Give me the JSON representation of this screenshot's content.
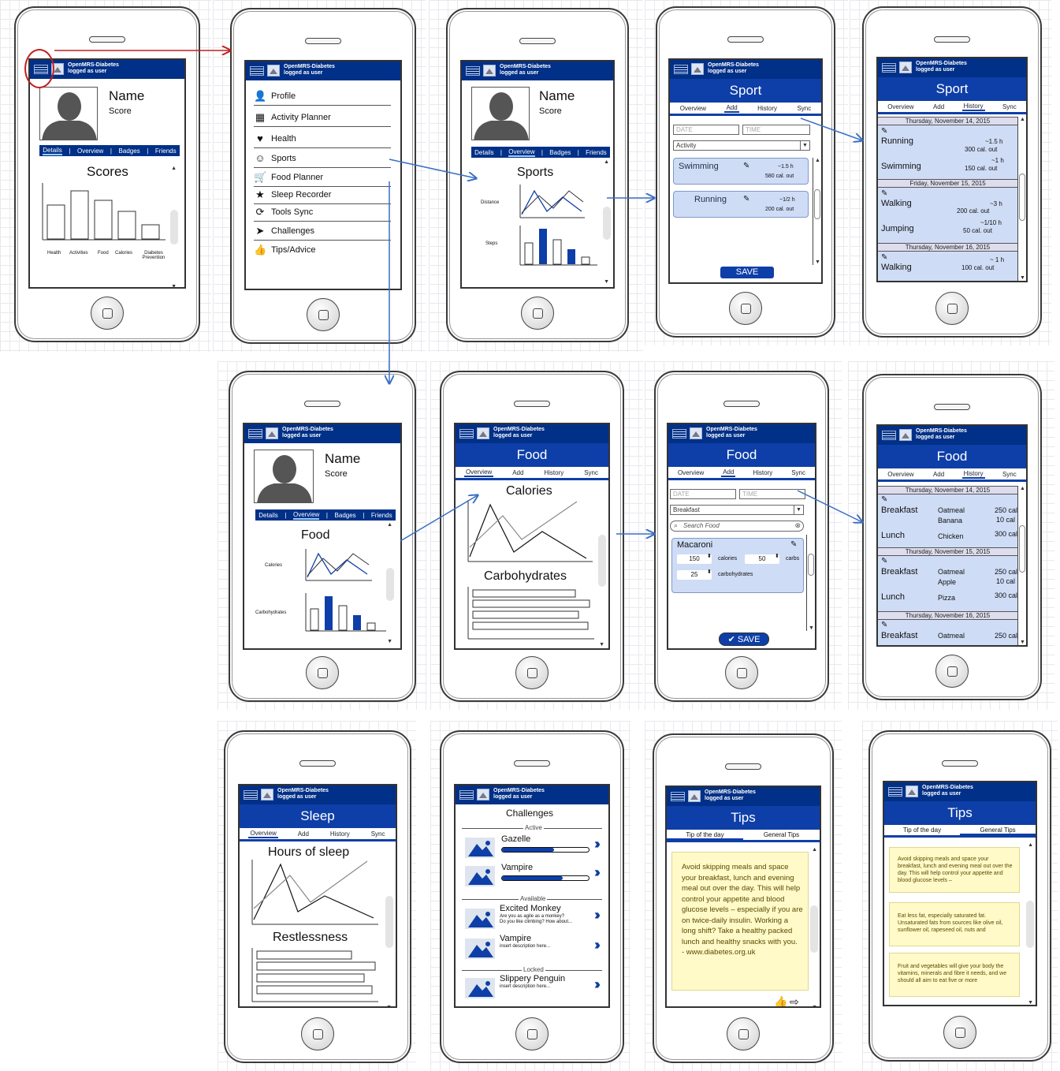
{
  "app": {
    "name": "OpenMRS-Diabetes",
    "login": "logged as user"
  },
  "profile": {
    "name": "Name",
    "score": "Score",
    "tabs": [
      "Details",
      "Overview",
      "Badges",
      "Friends"
    ],
    "scores_title": "Scores",
    "score_bars": [
      "Health",
      "Activities",
      "Food",
      "Calories",
      "Diabetes Prevention"
    ]
  },
  "menu": {
    "items": [
      "Profile",
      "Activity Planner",
      "Health",
      "Sports",
      "Food Planner",
      "Sleep Recorder",
      "Tools Sync",
      "Challenges",
      "Tips/Advice"
    ]
  },
  "sports_overview": {
    "title": "Sports",
    "distance": "Distance",
    "steps": "Steps"
  },
  "sport_add": {
    "title": "Sport",
    "tabs": [
      "Overview",
      "Add",
      "History",
      "Sync"
    ],
    "date_ph": "DATE",
    "time_ph": "TIME",
    "activity": "Activity",
    "entries": [
      {
        "name": "Swimming",
        "dur": "~1.5 h",
        "cal": "580 cal. out"
      },
      {
        "name": "Running",
        "dur": "~1/2 h",
        "cal": "200 cal. out"
      }
    ],
    "save": "SAVE"
  },
  "sport_history": {
    "title": "Sport",
    "days": [
      {
        "date": "Thursday, November 14, 2015",
        "items": [
          {
            "name": "Running",
            "dur": "~1.5 h",
            "cal": "300 cal. out"
          },
          {
            "name": "Swimming",
            "dur": "~1 h",
            "cal": "150 cal. out"
          }
        ]
      },
      {
        "date": "Friday, November 15, 2015",
        "items": [
          {
            "name": "Walking",
            "dur": "~3 h",
            "cal": "200 cal. out"
          },
          {
            "name": "Jumping",
            "dur": "~1/10 h",
            "cal": "50 cal. out"
          }
        ]
      },
      {
        "date": "Thursday, November 16, 2015",
        "items": [
          {
            "name": "Walking",
            "dur": "~ 1 h",
            "cal": "100 cal. out"
          }
        ]
      }
    ]
  },
  "profile_food": {
    "title": "Food",
    "calories": "Calories",
    "carbs": "Carbohydrates"
  },
  "food_overview": {
    "title": "Food",
    "calories": "Calories",
    "carbs": "Carbohydrates"
  },
  "food_add": {
    "title": "Food",
    "meal": "Breakfast",
    "search_ph": "Search Food",
    "item": "Macaroni",
    "cal_val": "150",
    "cal_lbl": "calories",
    "carb_val": "50",
    "carb_lbl": "carbs",
    "carb2_val": "25",
    "carb2_lbl": "carbohydrates",
    "save": "SAVE"
  },
  "food_history": {
    "title": "Food",
    "days": [
      {
        "date": "Thursday, November 14, 2015",
        "meals": [
          {
            "meal": "Breakfast",
            "foods": "Oatmeal",
            "foods2": "Banana",
            "cal": "250 cal",
            "cal2": "10 cal"
          },
          {
            "meal": "Lunch",
            "foods": "Chicken",
            "cal": "300 cal"
          }
        ]
      },
      {
        "date": "Thursday, November 15, 2015",
        "meals": [
          {
            "meal": "Breakfast",
            "foods": "Oatmeal",
            "foods2": "Apple",
            "cal": "250 cal",
            "cal2": "10 cal"
          },
          {
            "meal": "Lunch",
            "foods": "Pizza",
            "cal": "300 cal"
          }
        ]
      },
      {
        "date": "Thursday, November 16, 2015",
        "meals": [
          {
            "meal": "Breakfast",
            "foods": "Oatmeal",
            "cal": "250 cal"
          }
        ]
      }
    ]
  },
  "sleep": {
    "title": "Sleep",
    "hours": "Hours of sleep",
    "restless": "Restlessness"
  },
  "challenges": {
    "title": "Challenges",
    "active": "Active",
    "available": "Available",
    "locked": "Locked",
    "items": [
      {
        "name": "Gazelle"
      },
      {
        "name": "Vampire"
      },
      {
        "name": "Excited Monkey",
        "desc": "Are you as agile as a monkey?",
        "desc2": "Do you like climbing? How about..."
      },
      {
        "name": "Vampire",
        "desc": "insert description here..."
      },
      {
        "name": "Slippery Penguin",
        "desc": "insert description here..."
      }
    ]
  },
  "tips": {
    "title": "Tips",
    "tabs": [
      "Tip of the day",
      "General Tips"
    ],
    "tip": "Avoid skipping meals and space your breakfast, lunch and evening meal out over the day. This will help control your appetite and blood glucose levels – especially if you are on twice-daily insulin. Working a long shift? Take a healthy packed lunch and healthy snacks with you.",
    "tip_src": "- www.diabetes.org.uk"
  },
  "tips_general": {
    "title": "Tips",
    "items": [
      "Avoid skipping meals and space your breakfast, lunch and evening meal out over the day. This will help control your appetite and blood glucose levels –",
      "Eat less fat, especially saturated fat. Unsaturated fats from sources like olive oil, sunflower oil, rapeseed oil, nuts and",
      "Fruit and vegetables will give your body the vitamins, minerals and fibre it needs, and we should all aim to eat five or more"
    ]
  },
  "colors": {
    "navy": "#003087",
    "blue": "#0e3fa8",
    "light": "#cfdcf6",
    "note": "#fffac8",
    "red": "#c02020"
  }
}
